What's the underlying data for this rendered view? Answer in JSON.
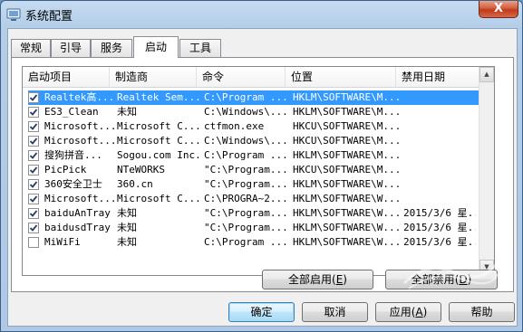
{
  "window": {
    "title": "系统配置",
    "close_label": "X"
  },
  "tabs": [
    {
      "label": "常规",
      "active": false
    },
    {
      "label": "引导",
      "active": false
    },
    {
      "label": "服务",
      "active": false
    },
    {
      "label": "启动",
      "active": true
    },
    {
      "label": "工具",
      "active": false
    }
  ],
  "columns": [
    "启动项目",
    "制造商",
    "命令",
    "位置",
    "禁用日期"
  ],
  "rows": [
    {
      "checked": true,
      "selected": true,
      "cells": [
        "Realtek高...",
        "Realtek Sem...",
        "C:\\Program ...",
        "HKLM\\SOFTWARE\\M...",
        ""
      ]
    },
    {
      "checked": true,
      "selected": false,
      "cells": [
        "ES3_Clean",
        "未知",
        "C:\\Windows\\...",
        "HKLM\\SOFTWARE\\M...",
        ""
      ]
    },
    {
      "checked": true,
      "selected": false,
      "cells": [
        "Microsoft...",
        "Microsoft C...",
        "ctfmon.exe",
        "HKCU\\SOFTWARE\\M...",
        ""
      ]
    },
    {
      "checked": true,
      "selected": false,
      "cells": [
        "Microsoft...",
        "Microsoft C...",
        "C:\\Windows\\...",
        "HKCU\\SOFTWARE\\M...",
        ""
      ]
    },
    {
      "checked": true,
      "selected": false,
      "cells": [
        "搜狗拼音...",
        "Sogou.com Inc.",
        "C:\\Program ...",
        "HKLM\\SOFTWARE\\M...",
        ""
      ]
    },
    {
      "checked": true,
      "selected": false,
      "cells": [
        "PicPick",
        "NTeWORKS",
        "\"C:\\Program...",
        "HKCU\\SOFTWARE\\M...",
        ""
      ]
    },
    {
      "checked": true,
      "selected": false,
      "cells": [
        "360安全卫士",
        "360.cn",
        "\"C:\\Program...",
        "HKLM\\SOFTWARE\\W...",
        ""
      ]
    },
    {
      "checked": true,
      "selected": false,
      "cells": [
        "Microsoft...",
        "Microsoft C...",
        "C:\\PROGRA~2...",
        "HKLM\\SOFTWARE\\W...",
        ""
      ]
    },
    {
      "checked": true,
      "selected": false,
      "cells": [
        "baiduAnTray",
        "未知",
        "\"C:\\Program...",
        "HKLM\\SOFTWARE\\W...",
        "2015/3/6 星..."
      ]
    },
    {
      "checked": true,
      "selected": false,
      "cells": [
        "baidusdTray",
        "未知",
        "\"C:\\Program...",
        "HKLM\\SOFTWARE\\W...",
        "2015/3/6 星..."
      ]
    },
    {
      "checked": false,
      "selected": false,
      "cells": [
        "MiWiFi",
        "未知",
        "C:\\Program ...",
        "HKLM\\SOFTWARE\\W...",
        "2015/3/6 星..."
      ]
    }
  ],
  "buttons": {
    "enable_all": {
      "label": "全部启用",
      "key": "E"
    },
    "disable_all": {
      "label": "全部禁用",
      "key": "D"
    },
    "ok": "确定",
    "cancel": "取消",
    "apply": {
      "label": "应用",
      "key": "A"
    },
    "help": "帮助"
  },
  "colors": {
    "selection": "#3399ff",
    "titlebar": "#b4cde8",
    "close": "#c03a1b"
  },
  "icons": {
    "app": "system-config-icon",
    "check": "checkmark-icon"
  }
}
